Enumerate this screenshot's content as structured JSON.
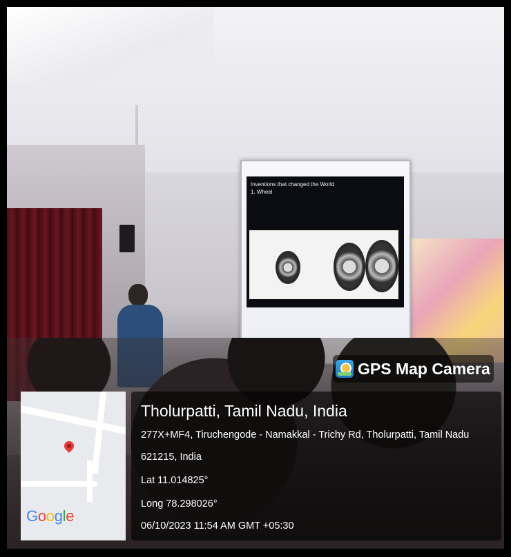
{
  "overlay": {
    "app_title": "GPS Map Camera",
    "app_icon": "gps-map-camera-icon",
    "location_name": "Tholurpatti, Tamil Nadu, India",
    "address_line1": "277X+MF4, Tiruchengode - Namakkal - Trichy Rd, Tholurpatti, Tamil Nadu",
    "address_line2": "621215, India",
    "latitude": "Lat 11.014825°",
    "longitude": "Long 78.298026°",
    "datetime": "06/10/2023 11:54 AM GMT +05:30",
    "map_brand": "Google",
    "map_pin_color": "#e53935"
  },
  "slide": {
    "title_line1": "Inventions that changed the World",
    "title_line2": "1. Wheel"
  }
}
